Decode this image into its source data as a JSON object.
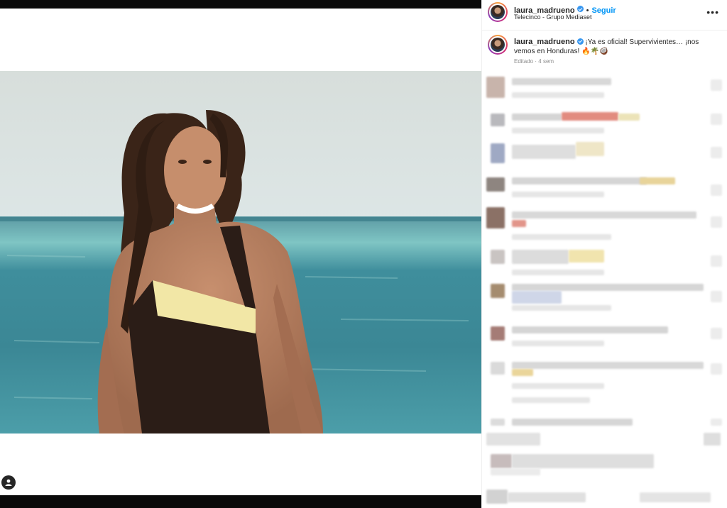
{
  "post": {
    "username": "laura_madrueno",
    "follow_label": "Seguir",
    "separator": "•",
    "location": "Telecinco - Grupo Mediaset",
    "more_label": "•••",
    "caption": {
      "username": "laura_madrueno",
      "text": "¡Ya es oficial! Supervivientes… ¡nos vemos en Honduras! 🔥🌴🥥",
      "edited": "Editado",
      "time": "4 sem",
      "meta_separator": "·"
    }
  },
  "icons": {
    "verified": "verified-badge-icon",
    "more": "more-options-icon",
    "tag": "tagged-user-icon"
  },
  "colors": {
    "accent": "#0095f6",
    "verified": "#3897f0",
    "sea": "#3f8f9b",
    "sky": "#d9e2e2",
    "swimsuit": "#2b1d17",
    "strap": "#f2e7a6"
  },
  "comments_state": "blurred"
}
